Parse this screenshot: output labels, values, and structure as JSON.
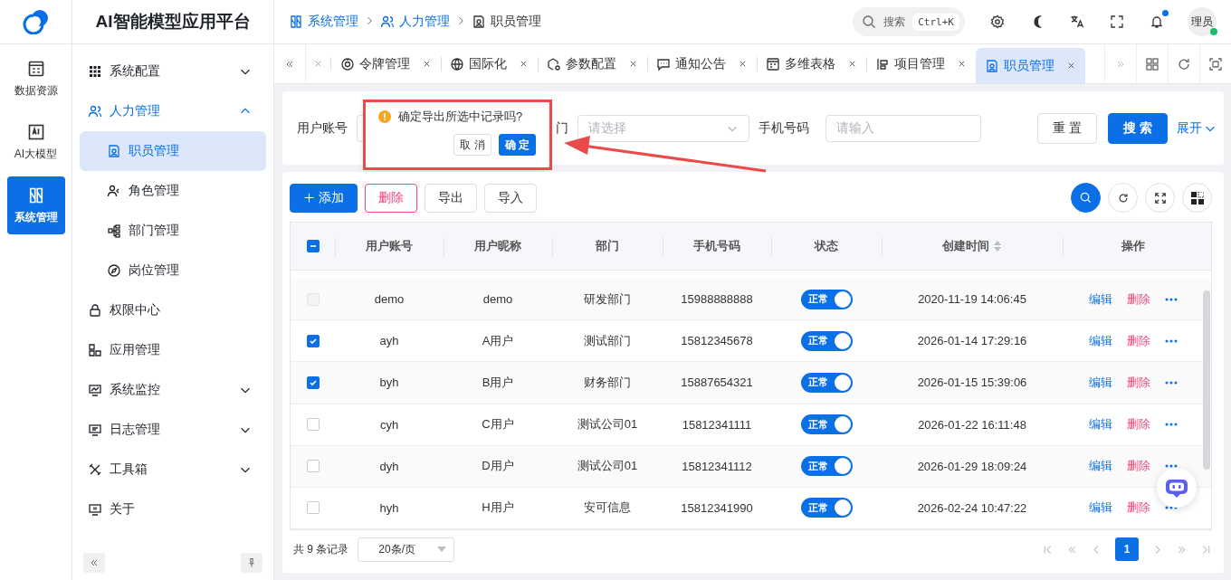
{
  "brand": {
    "title": "AI智能模型应用平台"
  },
  "rail": [
    {
      "label": "数据资源",
      "selected": false
    },
    {
      "label": "AI大模型",
      "selected": false
    },
    {
      "label": "系统管理",
      "selected": true
    }
  ],
  "menu": [
    {
      "label": "系统配置",
      "kind": "group",
      "expanded": false,
      "active": false
    },
    {
      "label": "人力管理",
      "kind": "group",
      "expanded": true,
      "active": true,
      "children": [
        {
          "label": "职员管理",
          "selected": true
        },
        {
          "label": "角色管理",
          "selected": false
        },
        {
          "label": "部门管理",
          "selected": false
        },
        {
          "label": "岗位管理",
          "selected": false
        }
      ]
    },
    {
      "label": "权限中心",
      "kind": "link",
      "active": false
    },
    {
      "label": "应用管理",
      "kind": "link",
      "active": false
    },
    {
      "label": "系统监控",
      "kind": "group",
      "expanded": false,
      "active": false
    },
    {
      "label": "日志管理",
      "kind": "group",
      "expanded": false,
      "active": false
    },
    {
      "label": "工具箱",
      "kind": "group",
      "expanded": false,
      "active": false
    },
    {
      "label": "关于",
      "kind": "link",
      "active": false
    }
  ],
  "header": {
    "breadcrumb": [
      "系统管理",
      "人力管理",
      "职员管理"
    ],
    "search": {
      "placeholder": "搜索",
      "shortcut": "Ctrl+K"
    },
    "has_unread": true,
    "avatar": {
      "text": "理员",
      "online": true
    }
  },
  "tabs": [
    {
      "label": "令牌管理",
      "selected": false
    },
    {
      "label": "国际化",
      "selected": false
    },
    {
      "label": "参数配置",
      "selected": false
    },
    {
      "label": "通知公告",
      "selected": false
    },
    {
      "label": "多维表格",
      "selected": false
    },
    {
      "label": "项目管理",
      "selected": false
    },
    {
      "label": "职员管理",
      "selected": true
    }
  ],
  "search_form": {
    "fields": [
      {
        "kind": "input",
        "label": "用户账号"
      },
      {
        "kind": "select",
        "label": "门",
        "placeholder": "请选择"
      },
      {
        "kind": "input",
        "label": "手机号码",
        "placeholder": "请输入"
      }
    ],
    "reset": "重 置",
    "submit": "搜 索",
    "expand": "展开"
  },
  "popconfirm": {
    "message": "确定导出所选中记录吗?",
    "cancel": "取 消",
    "ok": "确 定"
  },
  "toolbar": [
    {
      "label": "添加",
      "kind": "primary"
    },
    {
      "label": "删除",
      "kind": "danger"
    },
    {
      "label": "导出",
      "kind": "default"
    },
    {
      "label": "导入",
      "kind": "default"
    }
  ],
  "table": {
    "select_all": {
      "checked": true,
      "partial": true
    },
    "columns": [
      {
        "label": "用户账号",
        "sortable": false
      },
      {
        "label": "用户昵称",
        "sortable": false
      },
      {
        "label": "部门",
        "sortable": false
      },
      {
        "label": "手机号码",
        "sortable": false
      },
      {
        "label": "状态",
        "sortable": false
      },
      {
        "label": "创建时间",
        "sortable": true
      },
      {
        "label": "操作",
        "sortable": false
      }
    ],
    "rows": [
      {
        "checked": false,
        "disabled": true,
        "cells": [
          "demo",
          "demo",
          "研发部门",
          "15988888888"
        ],
        "status": {
          "label": "正常",
          "on": true
        },
        "created": "2020-11-19 14:06:45",
        "actions": [
          "编辑",
          "删除"
        ]
      },
      {
        "checked": true,
        "disabled": false,
        "cells": [
          "ayh",
          "A用户",
          "测试部门",
          "15812345678"
        ],
        "status": {
          "label": "正常",
          "on": true
        },
        "created": "2026-01-14 17:29:16",
        "actions": [
          "编辑",
          "删除"
        ]
      },
      {
        "checked": true,
        "disabled": false,
        "cells": [
          "byh",
          "B用户",
          "财务部门",
          "15887654321"
        ],
        "status": {
          "label": "正常",
          "on": true
        },
        "created": "2026-01-15 15:39:06",
        "actions": [
          "编辑",
          "删除"
        ]
      },
      {
        "checked": false,
        "disabled": false,
        "cells": [
          "cyh",
          "C用户",
          "测试公司01",
          "15812341111"
        ],
        "status": {
          "label": "正常",
          "on": true
        },
        "created": "2026-01-22 16:11:48",
        "actions": [
          "编辑",
          "删除"
        ]
      },
      {
        "checked": false,
        "disabled": false,
        "cells": [
          "dyh",
          "D用户",
          "测试公司01",
          "15812341112"
        ],
        "status": {
          "label": "正常",
          "on": true
        },
        "created": "2026-01-29 18:09:24",
        "actions": [
          "编辑",
          "删除"
        ]
      },
      {
        "checked": false,
        "disabled": false,
        "cells": [
          "hyh",
          "H用户",
          "安可信息",
          "15812341990"
        ],
        "status": {
          "label": "正常",
          "on": true
        },
        "created": "2026-02-24 10:47:22",
        "actions": [
          "编辑",
          "删除"
        ]
      }
    ]
  },
  "pagination": {
    "total": "共 9 条记录",
    "page_size": "20条/页",
    "pages": [
      {
        "label": "1",
        "selected": true
      }
    ]
  }
}
